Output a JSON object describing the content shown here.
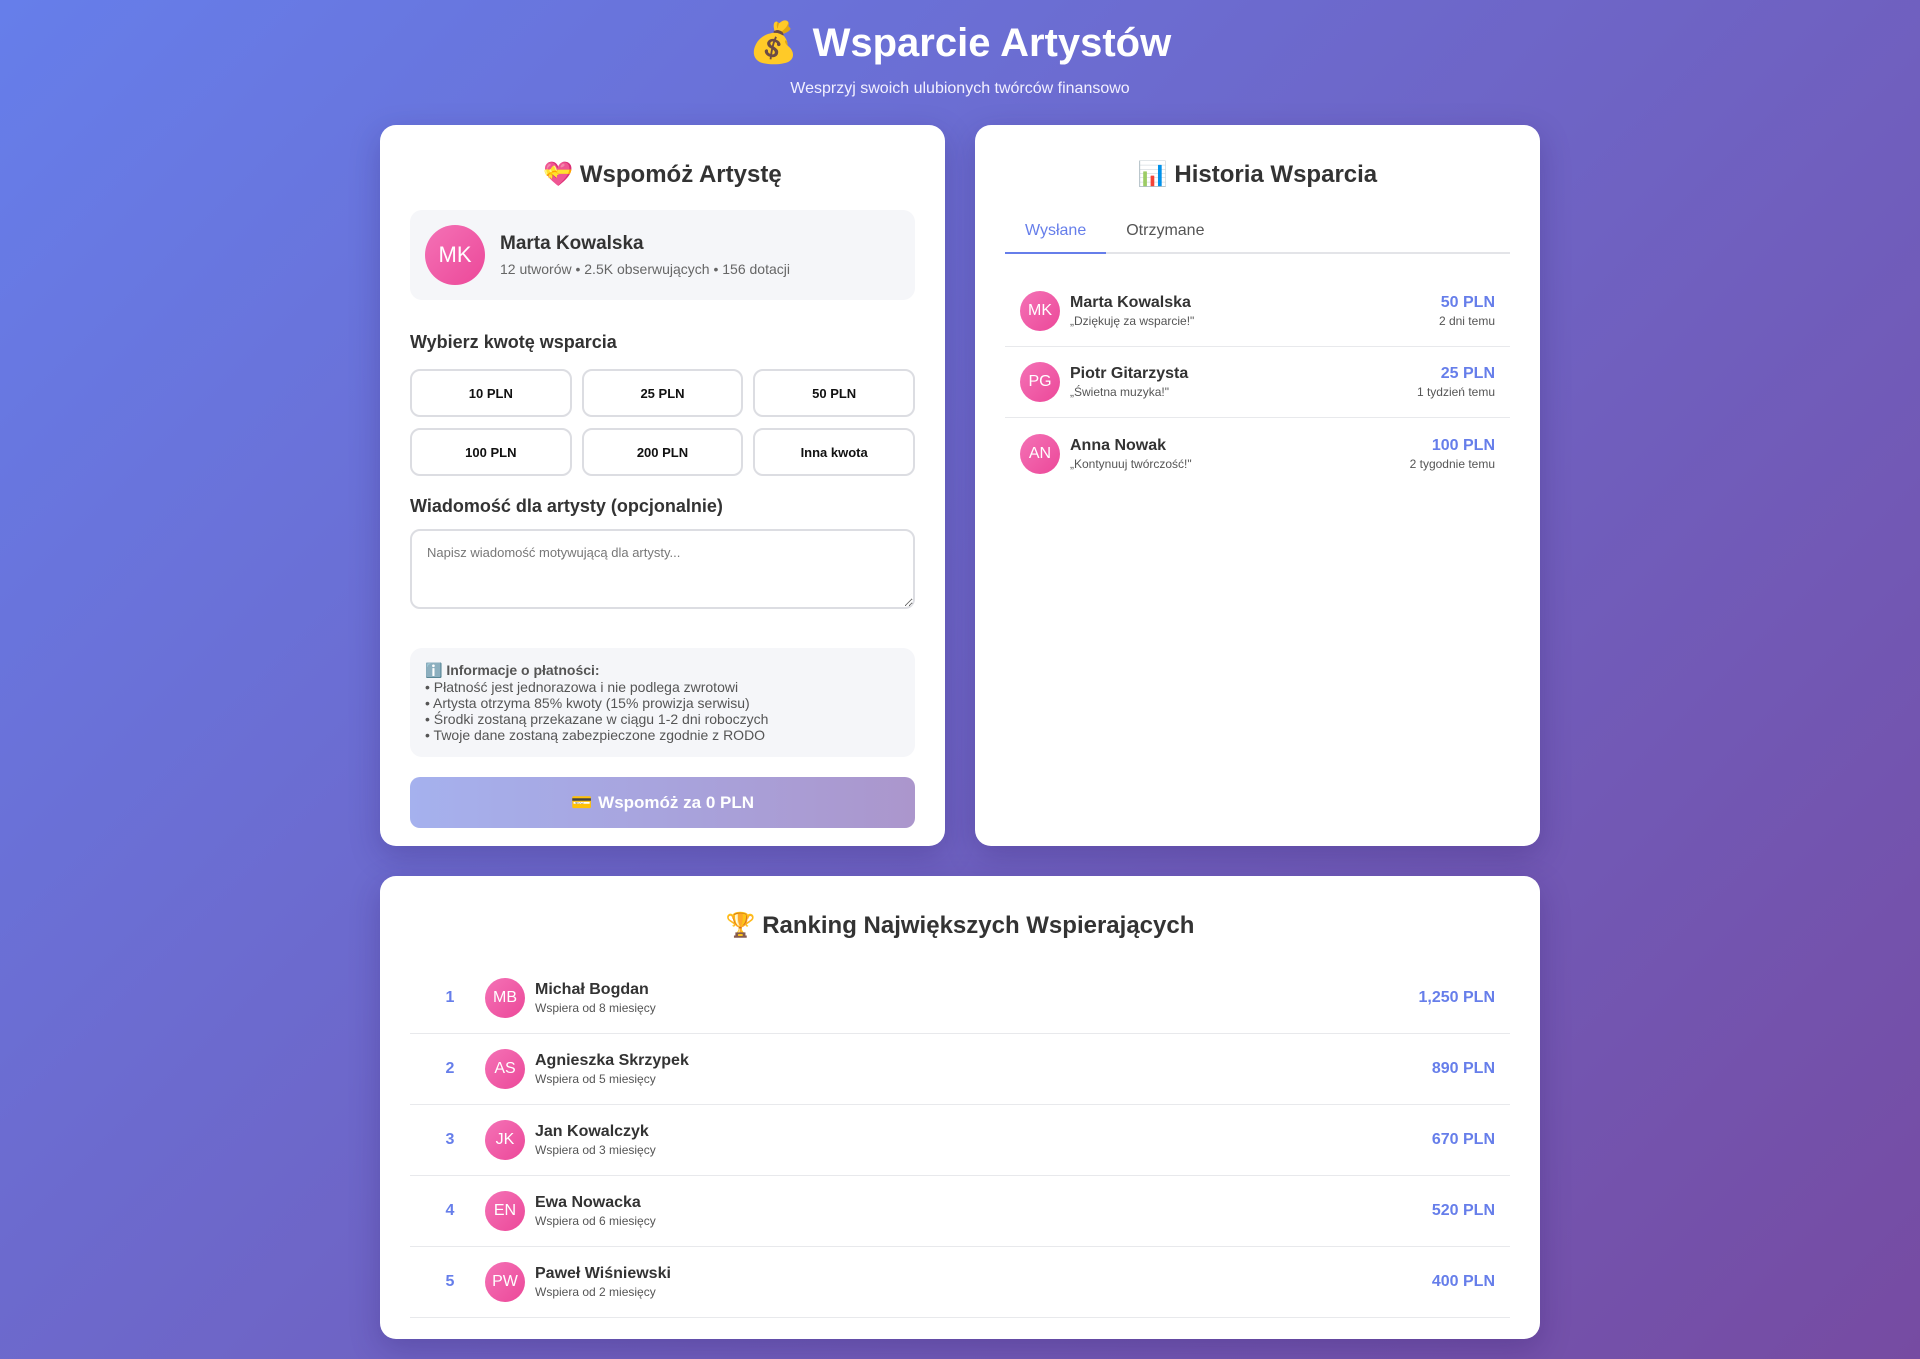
{
  "header": {
    "icon": "money-bag-icon",
    "icon_glyph": "💰",
    "title": "Wsparcie Artystów",
    "subtitle": "Wesprzyj swoich ulubionych twórców finansowo"
  },
  "support": {
    "icon_glyph": "💝",
    "title": "Wspomóż Artystę",
    "artist": {
      "initials": "MK",
      "name": "Marta Kowalska",
      "stats": "12 utworów • 2.5K obserwujących • 156 dotacji"
    },
    "amount_label": "Wybierz kwotę wsparcia",
    "amounts": [
      "10 PLN",
      "25 PLN",
      "50 PLN",
      "100 PLN",
      "200 PLN",
      "Inna kwota"
    ],
    "message_label": "Wiadomość dla artysty (opcjonalnie)",
    "message_placeholder": "Napisz wiadomość motywującą dla artysty...",
    "message_value": "",
    "info": {
      "icon_glyph": "ℹ️",
      "title": "Informacje o płatności:",
      "lines": [
        "• Płatność jest jednorazowa i nie podlega zwrotowi",
        "• Artysta otrzyma 85% kwoty (15% prowizja serwisu)",
        "• Środki zostaną przekazane w ciągu 1-2 dni roboczych",
        "• Twoje dane zostaną zabezpieczone zgodnie z RODO"
      ]
    },
    "submit_glyph": "💳",
    "submit_label": "Wspomóż za 0 PLN"
  },
  "history": {
    "icon_glyph": "📊",
    "title": "Historia Wsparcia",
    "tabs": [
      {
        "label": "Wysłane",
        "active": true
      },
      {
        "label": "Otrzymane",
        "active": false
      }
    ],
    "items": [
      {
        "initials": "MK",
        "name": "Marta Kowalska",
        "message": "„Dziękuję za wsparcie!\"",
        "amount": "50 PLN",
        "time": "2 dni temu"
      },
      {
        "initials": "PG",
        "name": "Piotr Gitarzysta",
        "message": "„Świetna muzyka!\"",
        "amount": "25 PLN",
        "time": "1 tydzień temu"
      },
      {
        "initials": "AN",
        "name": "Anna Nowak",
        "message": "„Kontynuuj twórczość!\"",
        "amount": "100 PLN",
        "time": "2 tygodnie temu"
      }
    ]
  },
  "ranking": {
    "icon_glyph": "🏆",
    "title": "Ranking Największych Wspierających",
    "items": [
      {
        "rank": "1",
        "initials": "MB",
        "name": "Michał Bogdan",
        "since": "Wspiera od 8 miesięcy",
        "amount": "1,250 PLN"
      },
      {
        "rank": "2",
        "initials": "AS",
        "name": "Agnieszka Skrzypek",
        "since": "Wspiera od 5 miesięcy",
        "amount": "890 PLN"
      },
      {
        "rank": "3",
        "initials": "JK",
        "name": "Jan Kowalczyk",
        "since": "Wspiera od 3 miesięcy",
        "amount": "670 PLN"
      },
      {
        "rank": "4",
        "initials": "EN",
        "name": "Ewa Nowacka",
        "since": "Wspiera od 6 miesięcy",
        "amount": "520 PLN"
      },
      {
        "rank": "5",
        "initials": "PW",
        "name": "Paweł Wiśniewski",
        "since": "Wspiera od 2 miesięcy",
        "amount": "400 PLN"
      }
    ]
  },
  "colors": {
    "background_start": "#667eea",
    "background_end": "#764ba2",
    "accent": "#667eea",
    "avatar": "#ec4899"
  }
}
